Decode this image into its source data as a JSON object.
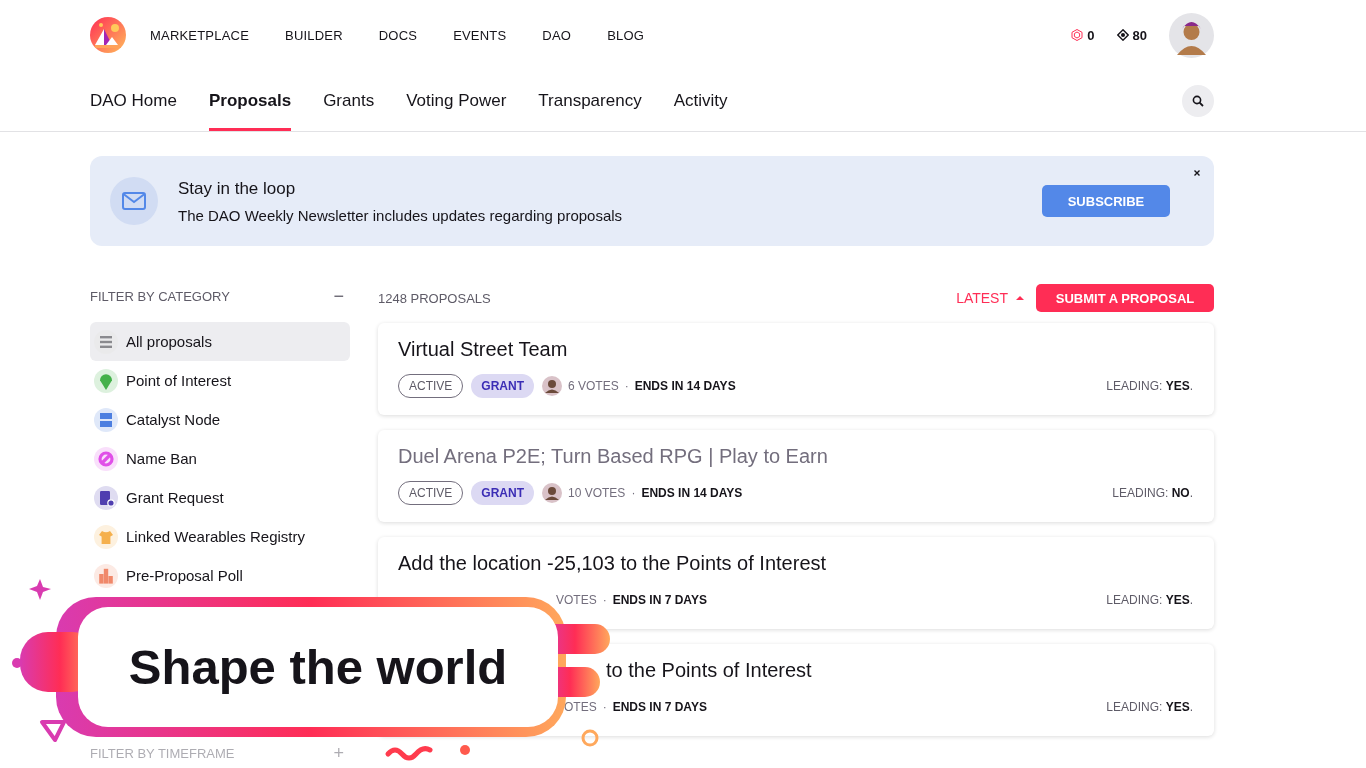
{
  "nav": {
    "links": [
      "MARKETPLACE",
      "BUILDER",
      "DOCS",
      "EVENTS",
      "DAO",
      "BLOG"
    ],
    "mana": "0",
    "points": "80"
  },
  "tabs": [
    {
      "label": "DAO Home",
      "selected": false
    },
    {
      "label": "Proposals",
      "selected": true
    },
    {
      "label": "Grants",
      "selected": false
    },
    {
      "label": "Voting Power",
      "selected": false
    },
    {
      "label": "Transparency",
      "selected": false
    },
    {
      "label": "Activity",
      "selected": false
    }
  ],
  "newsletter": {
    "title": "Stay in the loop",
    "text": "The DAO Weekly Newsletter includes updates regarding proposals",
    "button": "SUBSCRIBE"
  },
  "sidebar": {
    "heading": "FILTER BY CATEGORY",
    "toggle": "−",
    "items": [
      {
        "label": "All proposals",
        "kind": "list",
        "color": "#8a8a8e",
        "selected": true
      },
      {
        "label": "Point of Interest",
        "kind": "pin",
        "color": "#44b14a",
        "selected": false
      },
      {
        "label": "Catalyst Node",
        "kind": "server",
        "color": "#4d7fe0",
        "selected": false
      },
      {
        "label": "Name Ban",
        "kind": "ban",
        "color": "#e04fe8",
        "selected": false
      },
      {
        "label": "Grant Request",
        "kind": "doc",
        "color": "#4f3eb0",
        "selected": false
      },
      {
        "label": "Linked Wearables Registry",
        "kind": "shirt",
        "color": "#f5b04d",
        "selected": false
      },
      {
        "label": "Pre-Proposal Poll",
        "kind": "chart",
        "color": "#f0886a",
        "selected": false
      }
    ],
    "timeframe": {
      "heading": "FILTER BY TIMEFRAME",
      "toggle": "+"
    }
  },
  "list": {
    "count": "1248 PROPOSALS",
    "sort": "LATEST",
    "submit": "SUBMIT A PROPOSAL"
  },
  "proposals": [
    {
      "kind": "full",
      "title": "Virtual Street Team",
      "muted": false,
      "status": "ACTIVE",
      "category": "GRANT",
      "votes": "6 VOTES",
      "separator": "·",
      "ends": "ENDS IN 14 DAYS",
      "leading": "LEADING: **YES**."
    },
    {
      "kind": "full",
      "title": "Duel Arena P2E; Turn Based RPG | Play to Earn",
      "muted": true,
      "status": "ACTIVE",
      "category": "GRANT",
      "votes": "10 VOTES",
      "separator": "·",
      "ends": "ENDS IN 14 DAYS",
      "leading": "LEADING: **NO**."
    },
    {
      "kind": "covered_meta",
      "title": "Add the location -25,103 to the Points of Interest",
      "muted": false,
      "votes": "VOTES",
      "separator": "·",
      "ends": "ENDS IN 7 DAYS",
      "leading": "LEADING: **YES**."
    },
    {
      "kind": "covered_title",
      "title": "to the Points of Interest",
      "muted": false,
      "votes": "OTES",
      "separator": "·",
      "ends": "ENDS IN 7 DAYS",
      "leading": "LEADING: **YES**."
    }
  ],
  "promo": {
    "text": "Shape the world"
  }
}
